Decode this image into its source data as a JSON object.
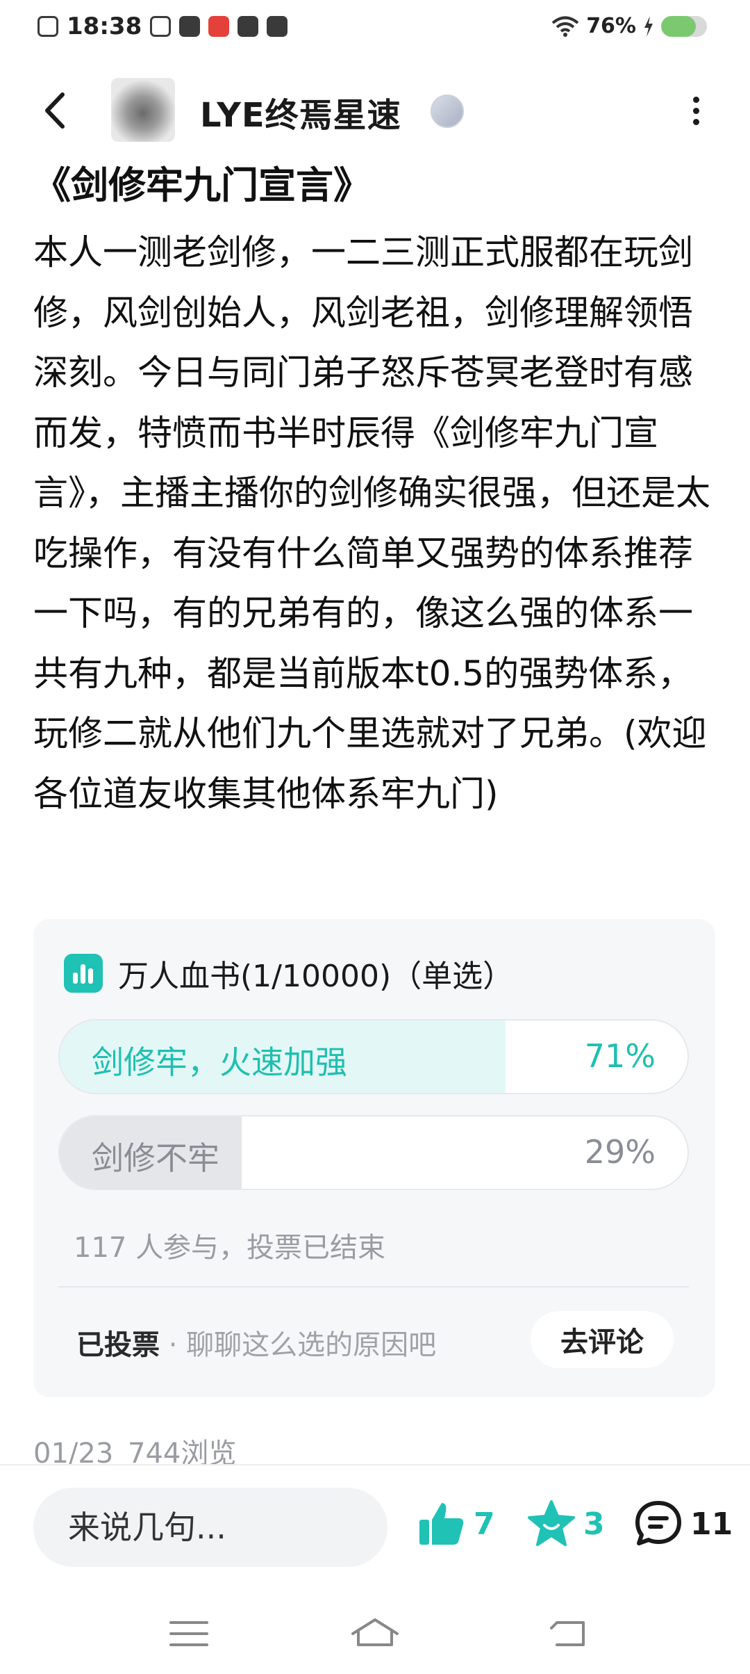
{
  "status_bar": {
    "time": "18:38",
    "battery_percent": "76%",
    "battery_level": 0.76,
    "accent": "#7bc96f"
  },
  "header": {
    "username": "LYE终焉星速",
    "back_icon": "chevron-left-icon",
    "more_icon": "more-vertical-icon"
  },
  "post": {
    "title": "《剑修牢九门宣言》",
    "body": "本人一测老剑修，一二三测正式服都在玩剑修，风剑创始人，风剑老祖，剑修理解领悟深刻。今日与同门弟子怒斥苍冥老登时有感而发，特愤而书半时辰得《剑修牢九门宣言》，主播主播你的剑修确实很强，但还是太吃操作，有没有什么简单又强势的体系推荐一下吗，有的兄弟有的，像这么强的体系一共有九种，都是当前版本t0.5的强势体系，玩修二就从他们九个里选就对了兄弟。(欢迎各位道友收集其他体系牢九门)",
    "date": "01/23",
    "views": "744浏览"
  },
  "vote": {
    "title": "万人血书(1/10000)",
    "mode": "（单选）",
    "options": [
      {
        "label": "剑修牢，火速加强",
        "percent_text": "71%",
        "percent": 71
      },
      {
        "label": "剑修不牢",
        "percent_text": "29%",
        "percent": 29
      }
    ],
    "status": "117 人参与，投票已结束",
    "voted_label": "已投票",
    "voted_prompt": " · 聊聊这么选的原因吧",
    "comment_button": "去评论",
    "accent": "#1fc2b4"
  },
  "action_bar": {
    "input_placeholder": "来说几句...",
    "like_count": "7",
    "favorite_count": "3",
    "comment_count": "11"
  }
}
